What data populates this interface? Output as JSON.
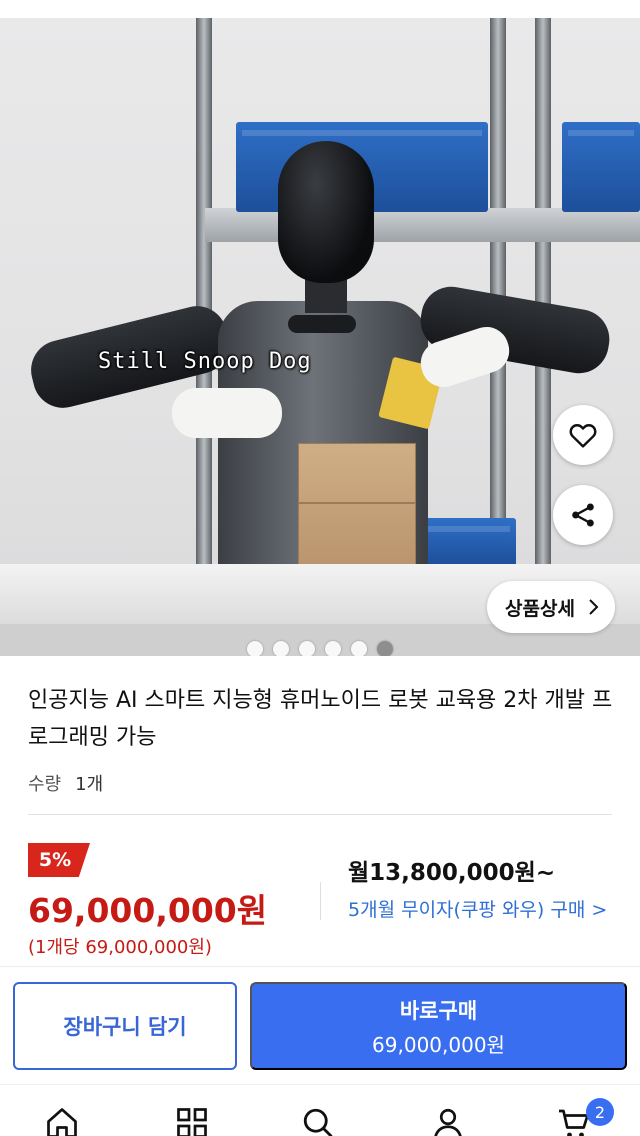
{
  "product_image": {
    "watermark": "Still Snoop Dog",
    "detail_button_label": "상품상세",
    "carousel": {
      "total": 6,
      "active": 5
    }
  },
  "product": {
    "title": "인공지능 AI 스마트 지능형 휴머노이드 로봇 교육용 2차 개발 프로그래밍 가능",
    "quantity_label": "수량",
    "quantity_value": "1개"
  },
  "pricing": {
    "discount": "5%",
    "price": "69,000,000원",
    "unit_price": "(1개당 69,000,000원)",
    "monthly": "월13,800,000원~",
    "installment": "5개월 무이자(쿠팡 와우) 구매 >"
  },
  "actions": {
    "cart_label": "장바구니 담기",
    "buy_label": "바로구매",
    "buy_price": "69,000,000원"
  },
  "bottom_nav": {
    "items": [
      "home-icon",
      "category-icon",
      "search-icon",
      "user-icon",
      "cart-icon"
    ],
    "cart_badge": "2"
  },
  "colors": {
    "accent_blue": "#3a6ef0",
    "price_red": "#c51b14",
    "link_blue": "#2f6fd6"
  }
}
